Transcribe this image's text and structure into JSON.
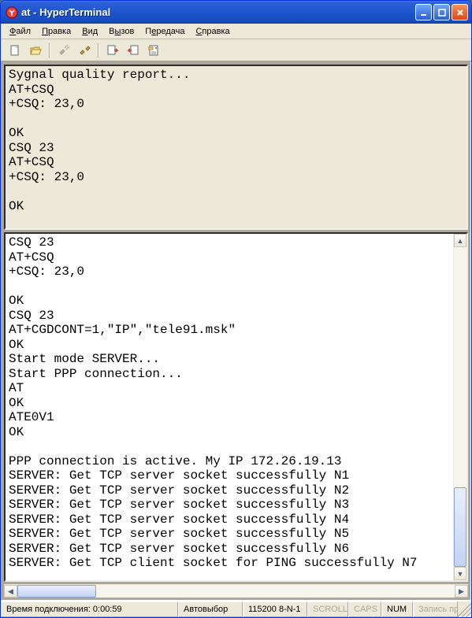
{
  "window": {
    "title": "at - HyperTerminal"
  },
  "menu": {
    "items": [
      {
        "label": "Файл",
        "accel": "Ф"
      },
      {
        "label": "Правка",
        "accel": "П"
      },
      {
        "label": "Вид",
        "accel": "В"
      },
      {
        "label": "Вызов",
        "accel": "ы"
      },
      {
        "label": "Передача",
        "accel": "е"
      },
      {
        "label": "Справка",
        "accel": "С"
      }
    ]
  },
  "toolbar": {
    "buttons": [
      {
        "name": "new-icon"
      },
      {
        "name": "open-icon"
      },
      {
        "name": "sep"
      },
      {
        "name": "connect-icon",
        "disabled": true
      },
      {
        "name": "disconnect-icon"
      },
      {
        "name": "sep"
      },
      {
        "name": "send-icon"
      },
      {
        "name": "receive-icon"
      },
      {
        "name": "properties-icon"
      }
    ]
  },
  "panes": {
    "upper_text": "Sygnal quality report...\nAT+CSQ\n+CSQ: 23,0\n\nOK\nCSQ 23\nAT+CSQ\n+CSQ: 23,0\n\nOK",
    "lower_text": "CSQ 23\nAT+CSQ\n+CSQ: 23,0\n\nOK\nCSQ 23\nAT+CGDCONT=1,\"IP\",\"tele91.msk\"\nOK\nStart mode SERVER...\nStart PPP connection...\nAT\nOK\nATE0V1\nOK\n\nPPP connection is active. My IP 172.26.19.13\nSERVER: Get TCP server socket successfully N1\nSERVER: Get TCP server socket successfully N2\nSERVER: Get TCP server socket successfully N3\nSERVER: Get TCP server socket successfully N4\nSERVER: Get TCP server socket successfully N5\nSERVER: Get TCP server socket successfully N6\nSERVER: Get TCP client socket for PING successfully N7"
  },
  "status": {
    "connection": "Время подключения: 0:00:59",
    "mode": "Автовыбор",
    "params": "115200 8-N-1",
    "scroll": "SCROLL",
    "caps": "CAPS",
    "num": "NUM",
    "record": "Запись пр"
  }
}
